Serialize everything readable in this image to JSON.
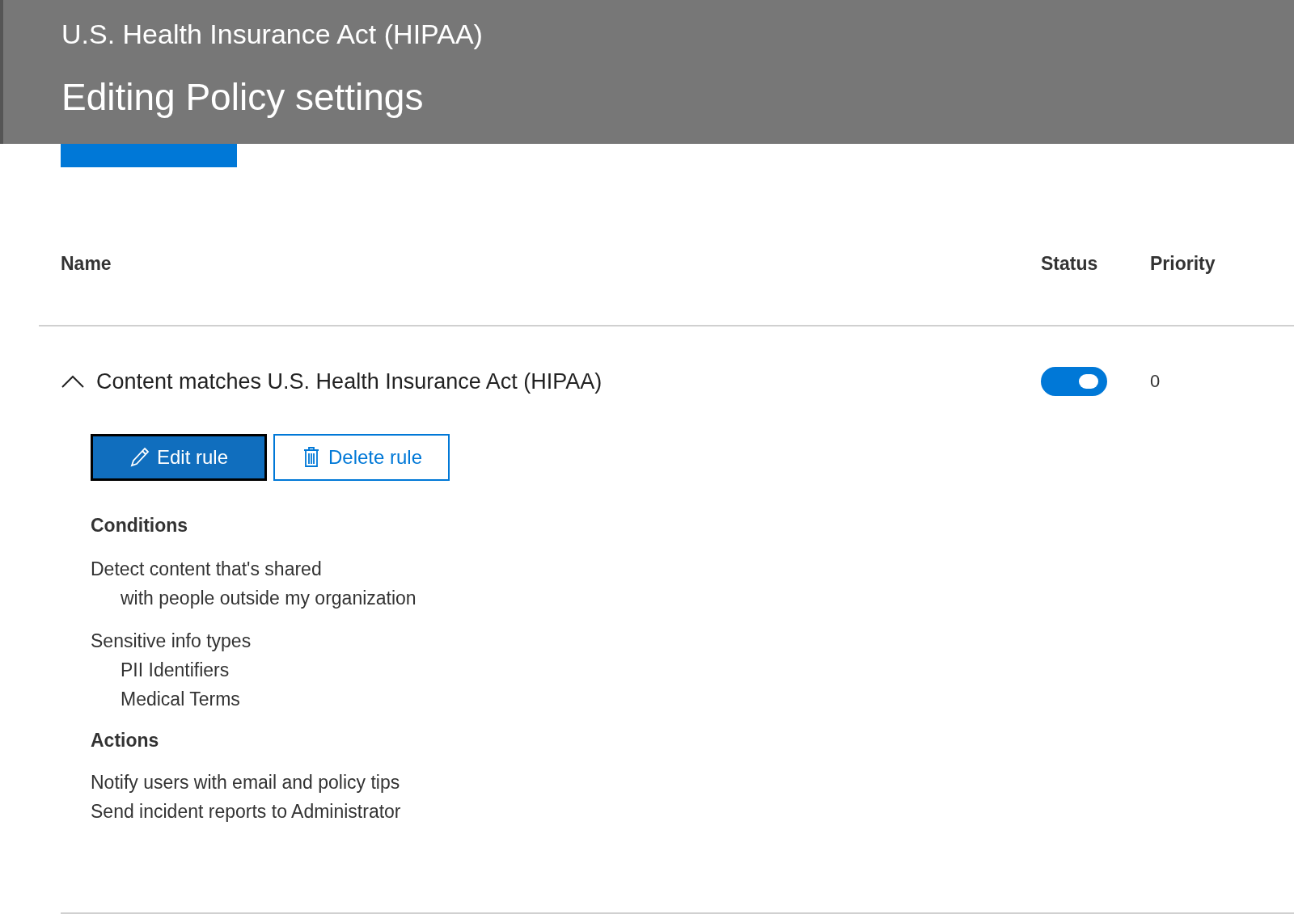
{
  "header": {
    "subtitle": "U.S. Health Insurance Act (HIPAA)",
    "title": "Editing Policy settings"
  },
  "table": {
    "columns": [
      "Name",
      "Status",
      "Priority"
    ]
  },
  "rules": [
    {
      "name": "Content matches U.S. Health Insurance Act (HIPAA)",
      "expanded": true,
      "on": true,
      "priority": "0",
      "buttons": [
        {
          "label": "Edit rule",
          "kind": "primary"
        },
        {
          "label": "Delete rule",
          "kind": "secondary"
        }
      ],
      "sections": [
        {
          "heading": "Conditions",
          "kind": "groups",
          "groups": [
            {
              "title": "Detect content that's shared",
              "items": [
                "with people outside my organization"
              ]
            },
            {
              "title": "Sensitive info types",
              "items": [
                "PII Identifiers",
                "Medical Terms"
              ]
            }
          ]
        },
        {
          "heading": "Actions",
          "kind": "lines",
          "lines": [
            "Notify users with email and policy tips",
            "Send incident reports to Administrator"
          ]
        }
      ]
    }
  ]
}
